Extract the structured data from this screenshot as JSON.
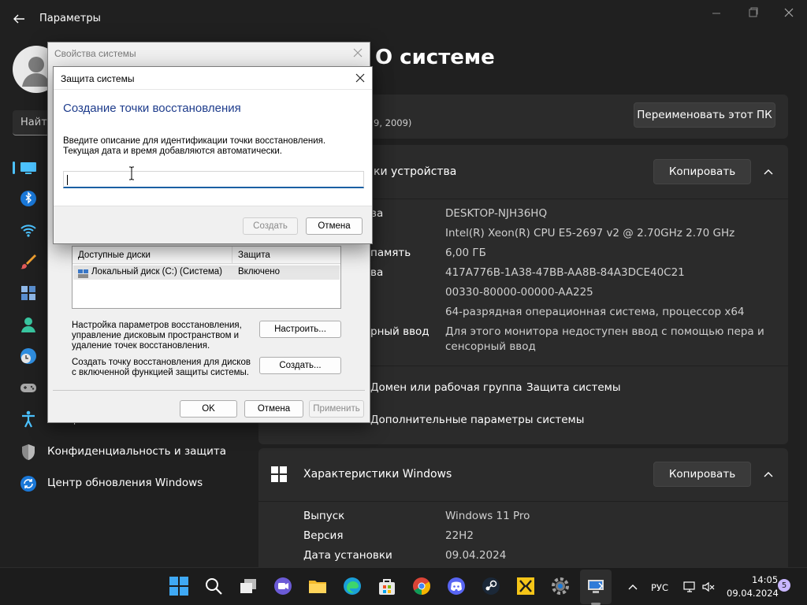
{
  "app": {
    "title": "Параметры"
  },
  "sidebar": {
    "search_placeholder": "Найти",
    "items": [
      {
        "label": "Специальные возможности"
      },
      {
        "label": "Конфиденциальность и защита"
      },
      {
        "label": "Центр обновления Windows"
      }
    ]
  },
  "main": {
    "page_title": "О системе",
    "pc_subtitle_fragment": "9, 2009)",
    "rename_button": "Переименовать этот ПК",
    "device_specs": {
      "heading_fragment": "ки устройства",
      "copy_button": "Копировать",
      "labels_fragments": [
        "ва",
        "",
        "память",
        "ва",
        "",
        "",
        "рный ввод"
      ],
      "values": [
        "DESKTOP-NJH36HQ",
        "Intel(R) Xeon(R) CPU E5-2697 v2 @ 2.70GHz   2.70 GHz",
        "6,00 ГБ",
        "417A776B-1A38-47BB-AA8B-84A3DCE40C21",
        "00330-80000-00000-AA225",
        "64-разрядная операционная система, процессор x64",
        "Для этого монитора недоступен ввод с помощью пера и",
        "сенсорный ввод"
      ]
    },
    "related_links": [
      "Домен или рабочая группа",
      "Защита системы",
      "Дополнительные параметры системы"
    ],
    "windows_specs": {
      "heading": "Характеристики Windows",
      "copy_button": "Копировать",
      "rows": [
        {
          "key": "Выпуск",
          "value": "Windows 11 Pro"
        },
        {
          "key": "Версия",
          "value": "22H2"
        },
        {
          "key": "Дата установки",
          "value": "09.04.2024"
        }
      ]
    }
  },
  "system_properties": {
    "title": "Свойства системы",
    "list_headers": [
      "Доступные диски",
      "Защита"
    ],
    "list_rows": [
      {
        "drive": "Локальный диск (C:) (Система)",
        "protection": "Включено"
      }
    ],
    "configure_text": "Настройка параметров восстановления, управление дисковым пространством и удаление точек восстановления.",
    "configure_button": "Настроить...",
    "create_text": "Создать точку восстановления для дисков с включенной функцией защиты системы.",
    "create_button": "Создать...",
    "ok_button": "OK",
    "cancel_button": "Отмена",
    "apply_button": "Применить"
  },
  "system_protection": {
    "title": "Защита системы",
    "heading": "Создание точки восстановления",
    "description": "Введите описание для идентификации точки восстановления. Текущая дата и время добавляются автоматически.",
    "input_value": "",
    "create_button": "Создать",
    "cancel_button": "Отмена"
  },
  "taskbar": {
    "language": "РУС",
    "time": "14:05",
    "date": "09.04.2024",
    "notification_count": "5"
  },
  "colors": {
    "accent": "#4cc2ff",
    "background": "#202020",
    "card": "#2b2b2b",
    "dialog_heading": "#1e3c8c"
  }
}
